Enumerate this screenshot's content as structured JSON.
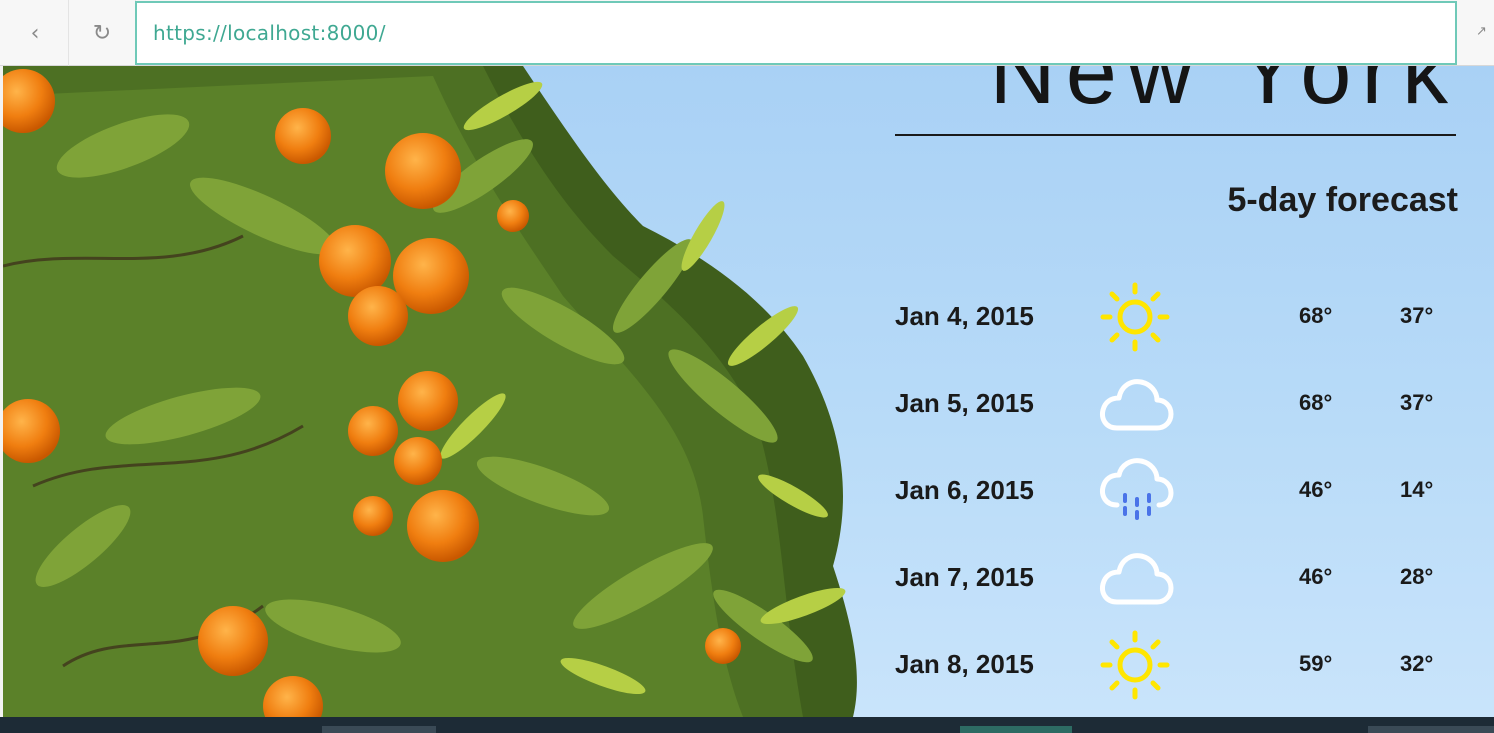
{
  "browser": {
    "url": "https://localhost:8000/",
    "back_icon": "chevron-left-icon",
    "reload_icon": "reload-icon",
    "corner_icon": "expand-icon"
  },
  "page": {
    "city": "New York",
    "forecast_heading": "5-day forecast",
    "days": [
      {
        "date": "Jan 4, 2015",
        "icon": "sun-icon",
        "high": "68°",
        "low": "37°"
      },
      {
        "date": "Jan 5, 2015",
        "icon": "cloud-icon",
        "high": "68°",
        "low": "37°"
      },
      {
        "date": "Jan 6, 2015",
        "icon": "rain-icon",
        "high": "46°",
        "low": "14°"
      },
      {
        "date": "Jan 7, 2015",
        "icon": "cloud-icon",
        "high": "46°",
        "low": "28°"
      },
      {
        "date": "Jan 8, 2015",
        "icon": "sun-icon",
        "high": "59°",
        "low": "32°"
      }
    ]
  },
  "colors": {
    "sun": "#ffe600",
    "rain": "#4a73e8",
    "cloud": "#ffffff",
    "url_text": "#3fa892",
    "url_border": "#6fc9b8"
  }
}
